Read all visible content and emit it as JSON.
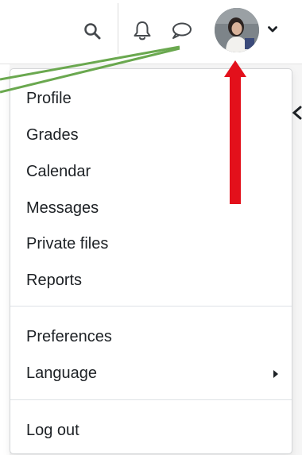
{
  "navbar": {
    "icons": [
      "search-icon",
      "bell-icon",
      "speech-bubble-icon",
      "chevron-down-icon"
    ],
    "avatar": "user-avatar"
  },
  "user_menu": {
    "items": [
      {
        "label": "Profile"
      },
      {
        "label": "Grades"
      },
      {
        "label": "Calendar"
      },
      {
        "label": "Messages"
      },
      {
        "label": "Private files"
      },
      {
        "label": "Reports"
      }
    ],
    "secondary_items": [
      {
        "label": "Preferences"
      },
      {
        "label": "Language",
        "has_submenu": true
      }
    ],
    "footer_items": [
      {
        "label": "Log out"
      }
    ]
  },
  "annotations": {
    "arrow_color": "#e3101b",
    "line_color": "#6aa84f"
  },
  "colors": {
    "text": "#1d2125",
    "border": "#d4d6d8",
    "background": "#ffffff",
    "page_background": "#f5f5f5"
  }
}
